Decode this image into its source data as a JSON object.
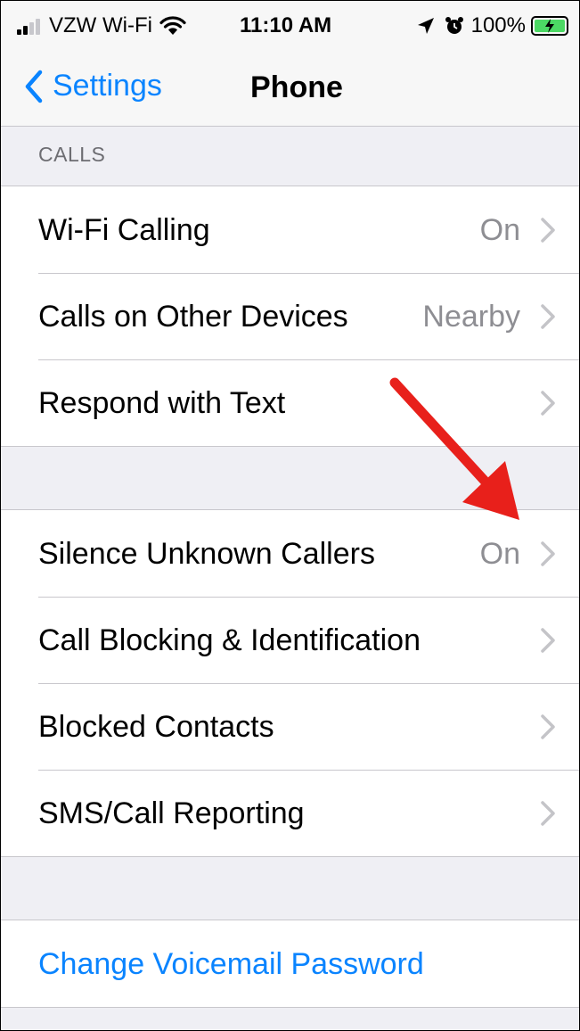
{
  "status_bar": {
    "carrier": "VZW Wi-Fi",
    "time": "11:10 AM",
    "battery": "100%"
  },
  "nav": {
    "back_label": "Settings",
    "title": "Phone"
  },
  "calls_section": {
    "header": "CALLS",
    "rows": [
      {
        "label": "Wi-Fi Calling",
        "value": "On"
      },
      {
        "label": "Calls on Other Devices",
        "value": "Nearby"
      },
      {
        "label": "Respond with Text",
        "value": ""
      }
    ]
  },
  "blocking_section": {
    "rows": [
      {
        "label": "Silence Unknown Callers",
        "value": "On"
      },
      {
        "label": "Call Blocking & Identification",
        "value": ""
      },
      {
        "label": "Blocked Contacts",
        "value": ""
      },
      {
        "label": "SMS/Call Reporting",
        "value": ""
      }
    ]
  },
  "voicemail_section": {
    "link_label": "Change Voicemail Password"
  },
  "colors": {
    "accent": "#0a84ff",
    "annotation_arrow": "#e8201b",
    "battery_fill": "#4cd964"
  },
  "icons": [
    "signal-icon",
    "wifi-icon",
    "location-icon",
    "alarm-icon",
    "battery-icon",
    "chevron-left-icon",
    "chevron-right-icon"
  ]
}
